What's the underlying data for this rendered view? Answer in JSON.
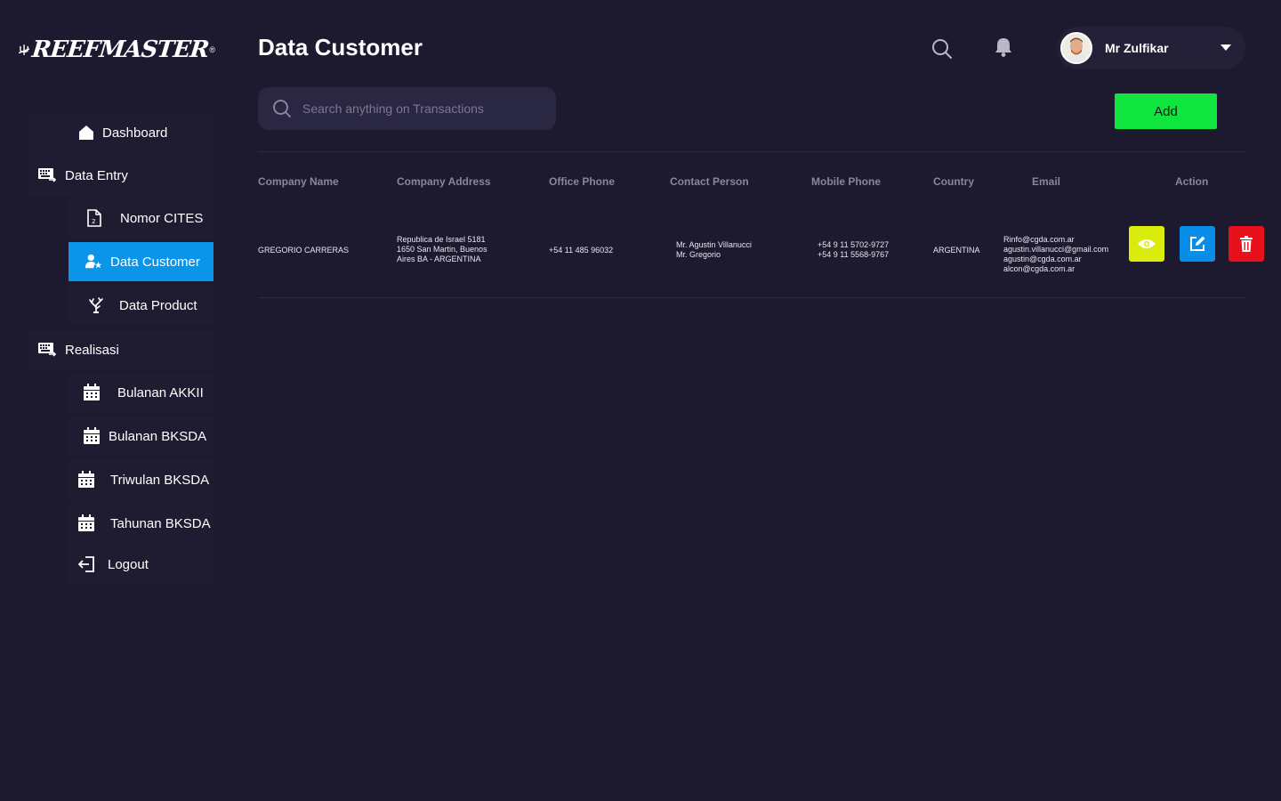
{
  "brand": {
    "name": "REEFMASTER",
    "registered": "®"
  },
  "sidebar": {
    "items": [
      {
        "label": "Dashboard",
        "icon": "home-icon"
      },
      {
        "label": "Data Entry",
        "icon": "keyboard-icon"
      },
      {
        "label": "Nomor CITES",
        "icon": "document-icon"
      },
      {
        "label": "Data Customer",
        "icon": "user-star-icon",
        "active": true
      },
      {
        "label": "Data Product",
        "icon": "coral-icon"
      },
      {
        "label": "Realisasi",
        "icon": "keyboard-icon"
      },
      {
        "label": "Bulanan AKKII",
        "icon": "calendar-icon"
      },
      {
        "label": "Bulanan BKSDA",
        "icon": "calendar-icon"
      },
      {
        "label": "Triwulan BKSDA",
        "icon": "calendar-icon"
      },
      {
        "label": "Tahunan BKSDA",
        "icon": "calendar-icon"
      },
      {
        "label": "Logout",
        "icon": "logout-icon"
      }
    ]
  },
  "header": {
    "title": "Data Customer",
    "user_name": "Mr Zulfikar"
  },
  "search": {
    "placeholder": "Search anything on Transactions"
  },
  "toolbar": {
    "add_label": "Add"
  },
  "table": {
    "columns": [
      "Company Name",
      "Company Address",
      "Office Phone",
      "Contact Person",
      "Mobile Phone",
      "Country",
      "Email",
      "Action"
    ],
    "rows": [
      {
        "company_name": "GREGORIO CARRERAS",
        "company_address": "Republica de Israel 5181\n1650 San Martin, Buenos\nAires BA - ARGENTINA",
        "office_phone": "+54 11 485 96032",
        "contact_person": "Mr. Agustin Villanucci\nMr. Gregorio",
        "mobile_phone": "+54 9 11 5702-9727\n+54 9 11 5568-9767",
        "country": "ARGENTINA",
        "email": "Rinfo@cgda.com.ar\nagustin.villanucci@gmail.com\nagustin@cgda.com.ar\nalcon@cgda.com.ar"
      }
    ]
  },
  "colors": {
    "background": "#1d1a2f",
    "active_nav": "#0a95ea",
    "add_button": "#10e53f",
    "view_button": "#d9ec0b",
    "edit_button": "#0a8de8",
    "delete_button": "#e8101a"
  }
}
